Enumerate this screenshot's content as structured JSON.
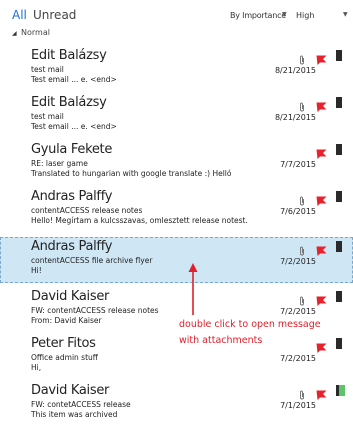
{
  "toolbar": {
    "tab_all": "All",
    "tab_unread": "Unread",
    "sort_by": "By Importance",
    "sort_order": "High"
  },
  "group": {
    "label": "Normal"
  },
  "messages": [
    {
      "sender": "Edit Balázsy",
      "subject": "test mail",
      "preview": "Test email ... e. <end>",
      "date": "8/21/2015",
      "attachment": true,
      "category": "black",
      "selected": false
    },
    {
      "sender": "Edit Balázsy",
      "subject": "test mail",
      "preview": "Test email ... e. <end>",
      "date": "8/21/2015",
      "attachment": true,
      "category": "black",
      "selected": false
    },
    {
      "sender": "Gyula Fekete",
      "subject": "RE: laser game",
      "preview": "Translated to hungarian with google translate :) Helló",
      "date": "7/7/2015",
      "attachment": false,
      "category": "black",
      "selected": false
    },
    {
      "sender": "Andras Palffy",
      "subject": "contentACCESS release notes",
      "preview": "Hello! Megírtam a kulcsszavas, omlesztett release notest.",
      "date": "7/6/2015",
      "attachment": true,
      "category": "black",
      "selected": false
    },
    {
      "sender": "Andras Palffy",
      "subject": "contentACCESS file archive flyer",
      "preview": "Hi!",
      "date": "7/2/2015",
      "attachment": true,
      "category": "black",
      "selected": true
    },
    {
      "sender": "David Kaiser",
      "subject": "FW: contentACCESS release notes",
      "preview": "From: David Kaiser",
      "date": "7/2/2015",
      "attachment": true,
      "category": "black",
      "selected": false
    },
    {
      "sender": "Peter Fitos",
      "subject": "Office admin stuff",
      "preview": "Hi,",
      "date": "7/2/2015",
      "attachment": false,
      "category": "black",
      "selected": false
    },
    {
      "sender": "David Kaiser",
      "subject": "FW: contetACCESS release",
      "preview": "This item was archived",
      "date": "7/1/2015",
      "attachment": true,
      "category": "green",
      "selected": false
    }
  ],
  "annotation": {
    "line1": "double click to open message",
    "line2": "with attachments",
    "color": "#e0202a"
  },
  "colors": {
    "accent": "#1f6fd0",
    "selected_bg": "#cfe6f5",
    "flag": "#e8222d",
    "category_green": "#5ec36a"
  },
  "icons": {
    "attachment": "paperclip-icon",
    "flag": "flag-icon",
    "category": "category-icon",
    "collapse": "collapse-triangle-icon",
    "sort": "chevron-down-icon"
  }
}
